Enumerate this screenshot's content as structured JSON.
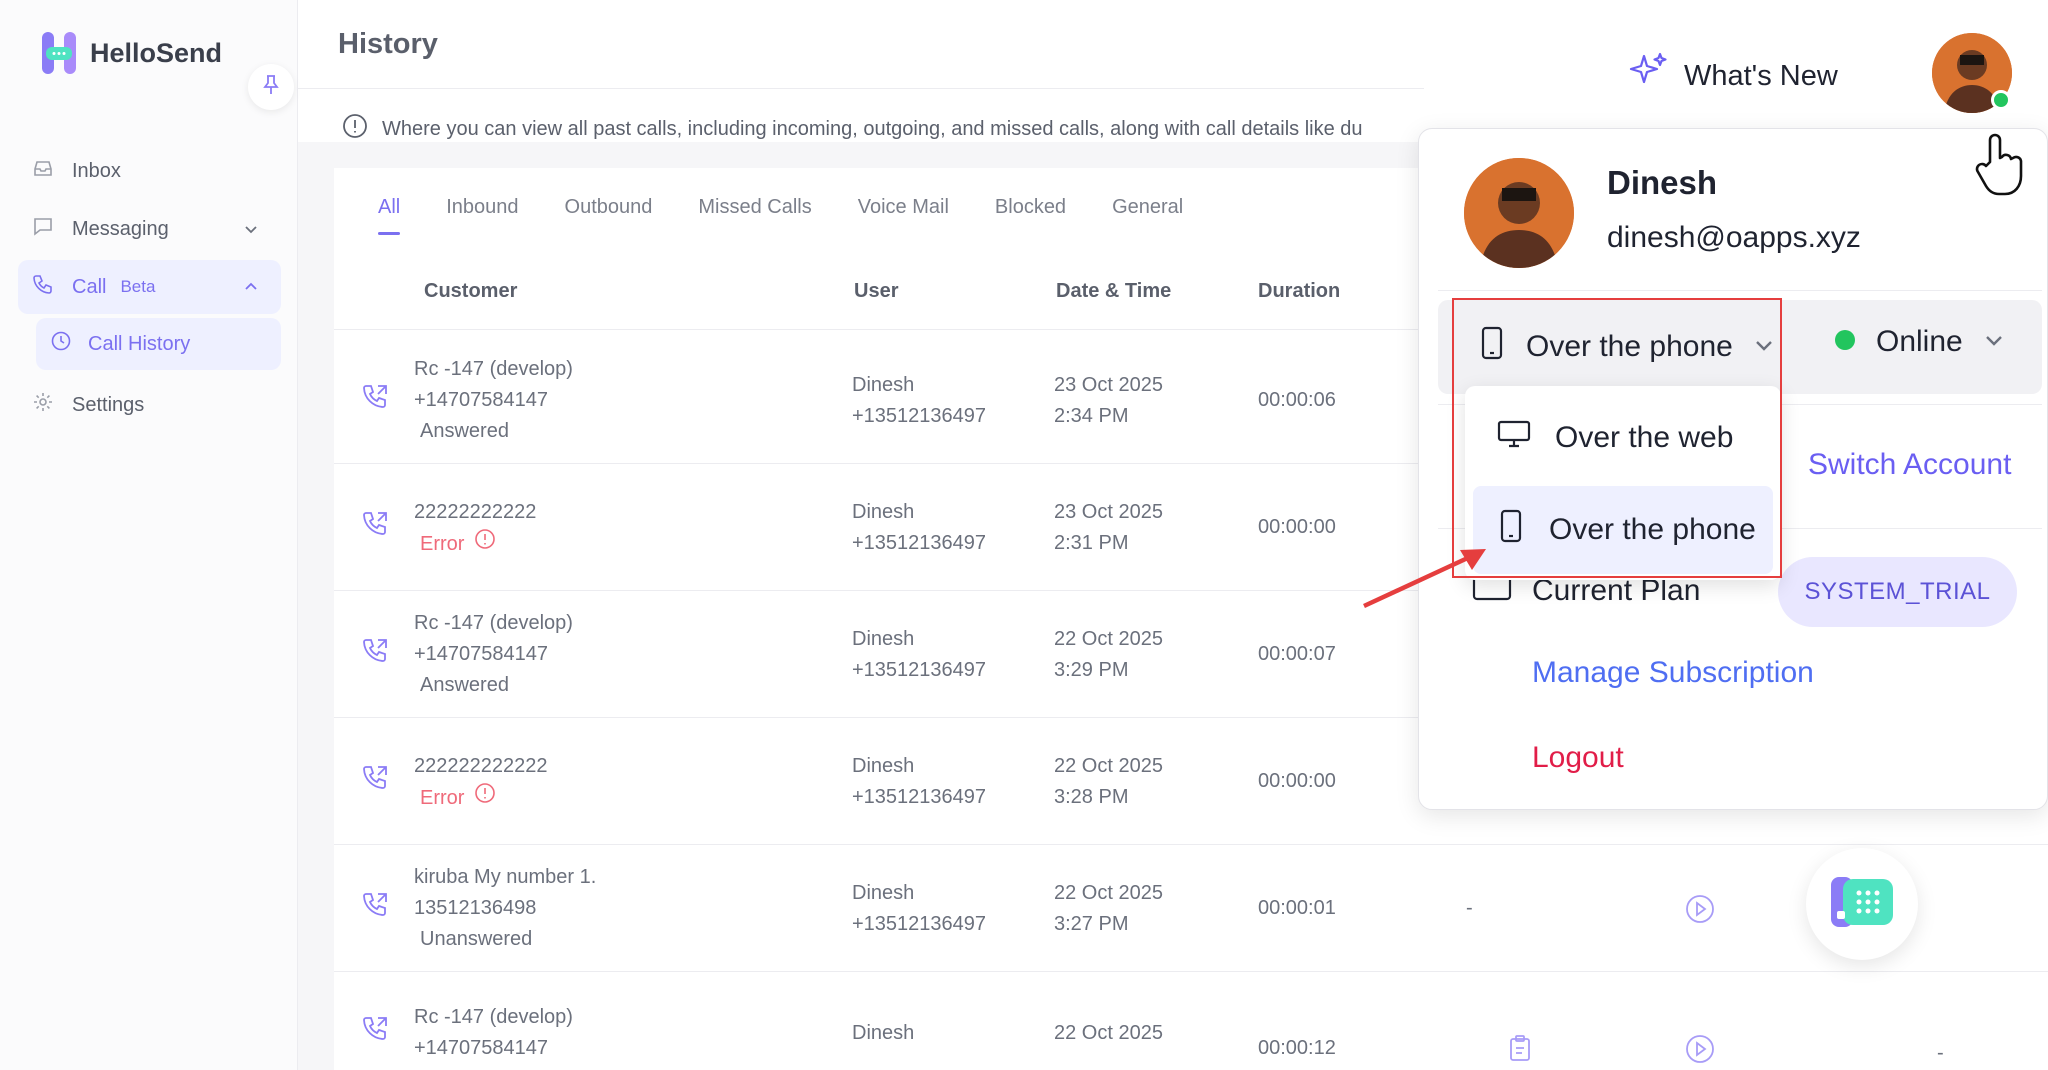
{
  "brand": {
    "name": "HelloSend"
  },
  "sidebar": {
    "items": [
      {
        "label": "Inbox",
        "icon": "inbox-icon"
      },
      {
        "label": "Messaging",
        "icon": "chat-icon"
      },
      {
        "label": "Call",
        "badge": "Beta",
        "icon": "phone-icon"
      },
      {
        "label": "Call History",
        "icon": "clock-icon"
      },
      {
        "label": "Settings",
        "icon": "gear-icon"
      }
    ]
  },
  "page": {
    "title": "History",
    "info": "Where you can view all past calls, including incoming, outgoing, and missed calls, along with call details like du"
  },
  "tabs": [
    "All",
    "Inbound",
    "Outbound",
    "Missed Calls",
    "Voice Mail",
    "Blocked",
    "General"
  ],
  "table": {
    "headers": {
      "customer": "Customer",
      "user": "User",
      "datetime": "Date & Time",
      "duration": "Duration"
    },
    "rows": [
      {
        "c1": "Rc -147 (develop)",
        "c2": "+14707584147",
        "c3": "Answered",
        "u1": "Dinesh",
        "u2": "+13512136497",
        "d1": "23 Oct 2025",
        "d2": "2:34 PM",
        "dur": "00:00:06"
      },
      {
        "c1": "22222222222",
        "c3": "Error",
        "u1": "Dinesh",
        "u2": "+13512136497",
        "d1": "23 Oct 2025",
        "d2": "2:31 PM",
        "dur": "00:00:00"
      },
      {
        "c1": "Rc -147 (develop)",
        "c2": "+14707584147",
        "c3": "Answered",
        "u1": "Dinesh",
        "u2": "+13512136497",
        "d1": "22 Oct 2025",
        "d2": "3:29 PM",
        "dur": "00:00:07"
      },
      {
        "c1": "222222222222",
        "c3": "Error",
        "u1": "Dinesh",
        "u2": "+13512136497",
        "d1": "22 Oct 2025",
        "d2": "3:28 PM",
        "dur": "00:00:00"
      },
      {
        "c1": "kiruba My number 1.",
        "c2": "13512136498",
        "c3": "Unanswered",
        "u1": "Dinesh",
        "u2": "+13512136497",
        "d1": "22 Oct 2025",
        "d2": "3:27 PM",
        "dur": "00:00:01",
        "extra": "-"
      },
      {
        "c1": "Rc -147 (develop)",
        "c2": "+14707584147",
        "u1": "Dinesh",
        "d1": "22 Oct 2025",
        "dur": "00:00:12",
        "extra2": "-"
      }
    ]
  },
  "header": {
    "whats_new": "What's New"
  },
  "profile": {
    "name": "Dinesh",
    "email": "dinesh@oapps.xyz",
    "mode": "Over the phone",
    "status": "Online",
    "switch_account": "Switch Account",
    "plan_label": "Current Plan",
    "plan": "SYSTEM_TRIAL",
    "manage": "Manage Subscription",
    "logout": "Logout",
    "options": [
      "Over the web",
      "Over the phone"
    ]
  },
  "colors": {
    "accent": "#7b70f0",
    "error": "#ef6a7a",
    "online": "#22c55e",
    "logout": "#e11d48",
    "annotation": "#e53e3e"
  }
}
